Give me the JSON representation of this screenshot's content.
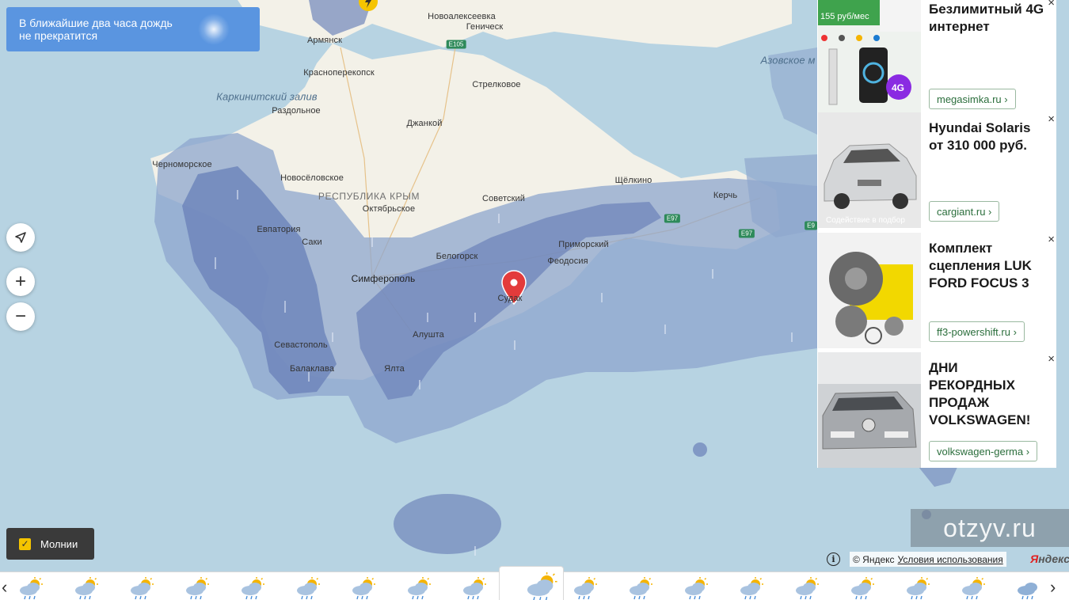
{
  "alert": {
    "text_line1": "В ближайшие два часа дождь",
    "text_line2": "не прекратится"
  },
  "controls": {
    "locate_icon": "location-arrow-icon",
    "zoom_in": "+",
    "zoom_out": "−"
  },
  "layers": {
    "lightning_label": "Молнии",
    "lightning_checked": true
  },
  "places": [
    {
      "name": "Новоалексеевка",
      "kind": "city"
    },
    {
      "name": "Геническ",
      "kind": "city"
    },
    {
      "name": "Армянск",
      "kind": "city"
    },
    {
      "name": "Красноперекопск",
      "kind": "city"
    },
    {
      "name": "Каркинитский залив",
      "kind": "sea"
    },
    {
      "name": "Раздольное",
      "kind": "city"
    },
    {
      "name": "Стрелковое",
      "kind": "city"
    },
    {
      "name": "Джанкой",
      "kind": "city"
    },
    {
      "name": "Азовское м",
      "kind": "sea"
    },
    {
      "name": "Черноморское",
      "kind": "city"
    },
    {
      "name": "Новосёловское",
      "kind": "city"
    },
    {
      "name": "РЕСПУБЛИКА КРЫМ",
      "kind": "region"
    },
    {
      "name": "Октябрьское",
      "kind": "city"
    },
    {
      "name": "Советский",
      "kind": "city"
    },
    {
      "name": "Щёлкино",
      "kind": "city"
    },
    {
      "name": "Керчь",
      "kind": "city"
    },
    {
      "name": "Евпатория",
      "kind": "city"
    },
    {
      "name": "Саки",
      "kind": "city"
    },
    {
      "name": "Приморский",
      "kind": "city"
    },
    {
      "name": "Белогорск",
      "kind": "city"
    },
    {
      "name": "Феодосия",
      "kind": "city"
    },
    {
      "name": "Симферополь",
      "kind": "city-big"
    },
    {
      "name": "Судак",
      "kind": "city"
    },
    {
      "name": "Алушта",
      "kind": "city"
    },
    {
      "name": "Севастополь",
      "kind": "city"
    },
    {
      "name": "Балаклава",
      "kind": "city"
    },
    {
      "name": "Ялта",
      "kind": "city"
    }
  ],
  "roads": [
    "E105",
    "E97",
    "E97",
    "E9"
  ],
  "ads": [
    {
      "title": "Безлимитный 4G интернет",
      "link": "megasimka.ru",
      "img_caption": "155 руб/мес"
    },
    {
      "title": "Hyundai Solaris от 310 000 руб.",
      "link": "cargiant.ru",
      "img_caption": "Содействие в подбор"
    },
    {
      "title": "Комплект сцепления LUK FORD FOCUS 3",
      "link": "ff3-powershift.ru",
      "img_caption": ""
    },
    {
      "title": "ДНИ РЕКОРДНЫХ ПРОДАЖ VOLKSWAGEN!",
      "link": "volkswagen-germa",
      "img_caption": ""
    }
  ],
  "ad_close": "×",
  "ad_link_arrow": "›",
  "watermark": "otzyv.ru",
  "copyright": {
    "prefix": "© Яндекс",
    "terms": "Условия использования"
  },
  "logo": {
    "first": "Я",
    "rest": "ндекс"
  },
  "info_icon": "i",
  "timeline": {
    "prev": "‹",
    "next": "›",
    "slots": 19,
    "active_index": 9,
    "icons": [
      "partly-cloudy-rain-icon",
      "partly-cloudy-rain-icon",
      "partly-cloudy-rain-icon",
      "partly-cloudy-rain-icon",
      "partly-cloudy-rain-icon",
      "partly-cloudy-rain-icon",
      "partly-cloudy-rain-icon",
      "partly-cloudy-rain-icon",
      "partly-cloudy-rain-icon",
      "partly-cloudy-rain-icon",
      "partly-cloudy-rain-icon",
      "partly-cloudy-rain-icon",
      "partly-cloudy-rain-icon",
      "partly-cloudy-rain-icon",
      "partly-cloudy-rain-icon",
      "partly-cloudy-rain-icon",
      "partly-cloudy-rain-icon",
      "partly-cloudy-rain-icon",
      "cloud-rain-icon"
    ]
  },
  "colors": {
    "sea": "#b7d3e2",
    "land": "#f3f1e8",
    "precip_light": "#9fb3d4",
    "precip_heavy": "#6f86bb",
    "marker": "#e33b3b",
    "alert_bg": "#5a95e0"
  }
}
